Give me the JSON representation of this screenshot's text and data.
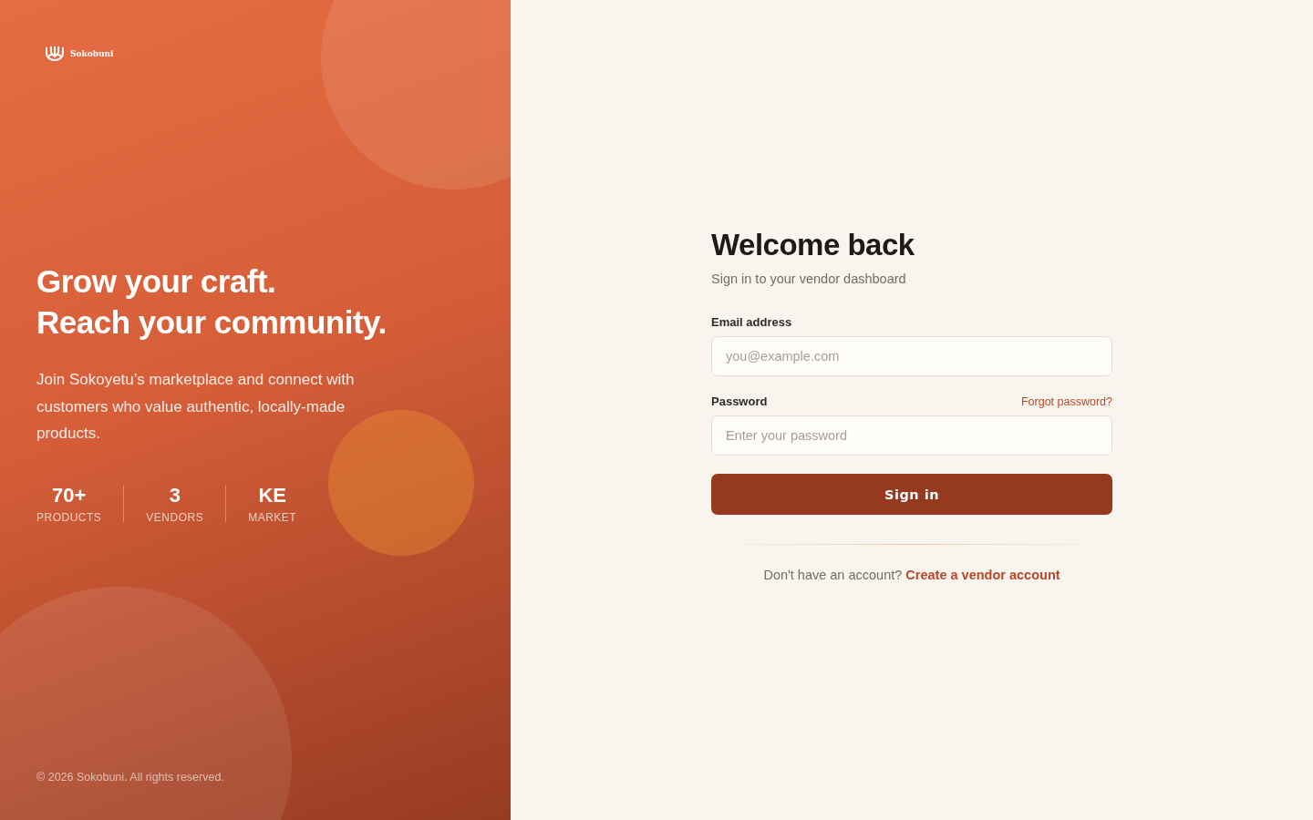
{
  "brand": {
    "name": "Sokobuni"
  },
  "hero": {
    "headline": [
      "Grow your craft.",
      "Reach your community."
    ],
    "description": "Join Sokoyetu’s marketplace and connect with customers who value authentic, locally-made products.",
    "stats": [
      {
        "value": "70+",
        "label": "PRODUCTS"
      },
      {
        "value": "3",
        "label": "VENDORS"
      },
      {
        "value": "KE",
        "label": "MARKET"
      }
    ]
  },
  "footer": "© 2026 Sokobuni. All rights reserved.",
  "form": {
    "title": "Welcome back",
    "subtitle": "Sign in to your vendor dashboard",
    "fields": [
      {
        "label": "Email address",
        "placeholder": "you@example.com"
      },
      {
        "label": "Password",
        "placeholder": "Enter your password",
        "link": "Forgot password?"
      }
    ],
    "submit": "Sign in",
    "signup_prompt": "Don't have an account?",
    "signup_link": "Create a vendor account"
  }
}
